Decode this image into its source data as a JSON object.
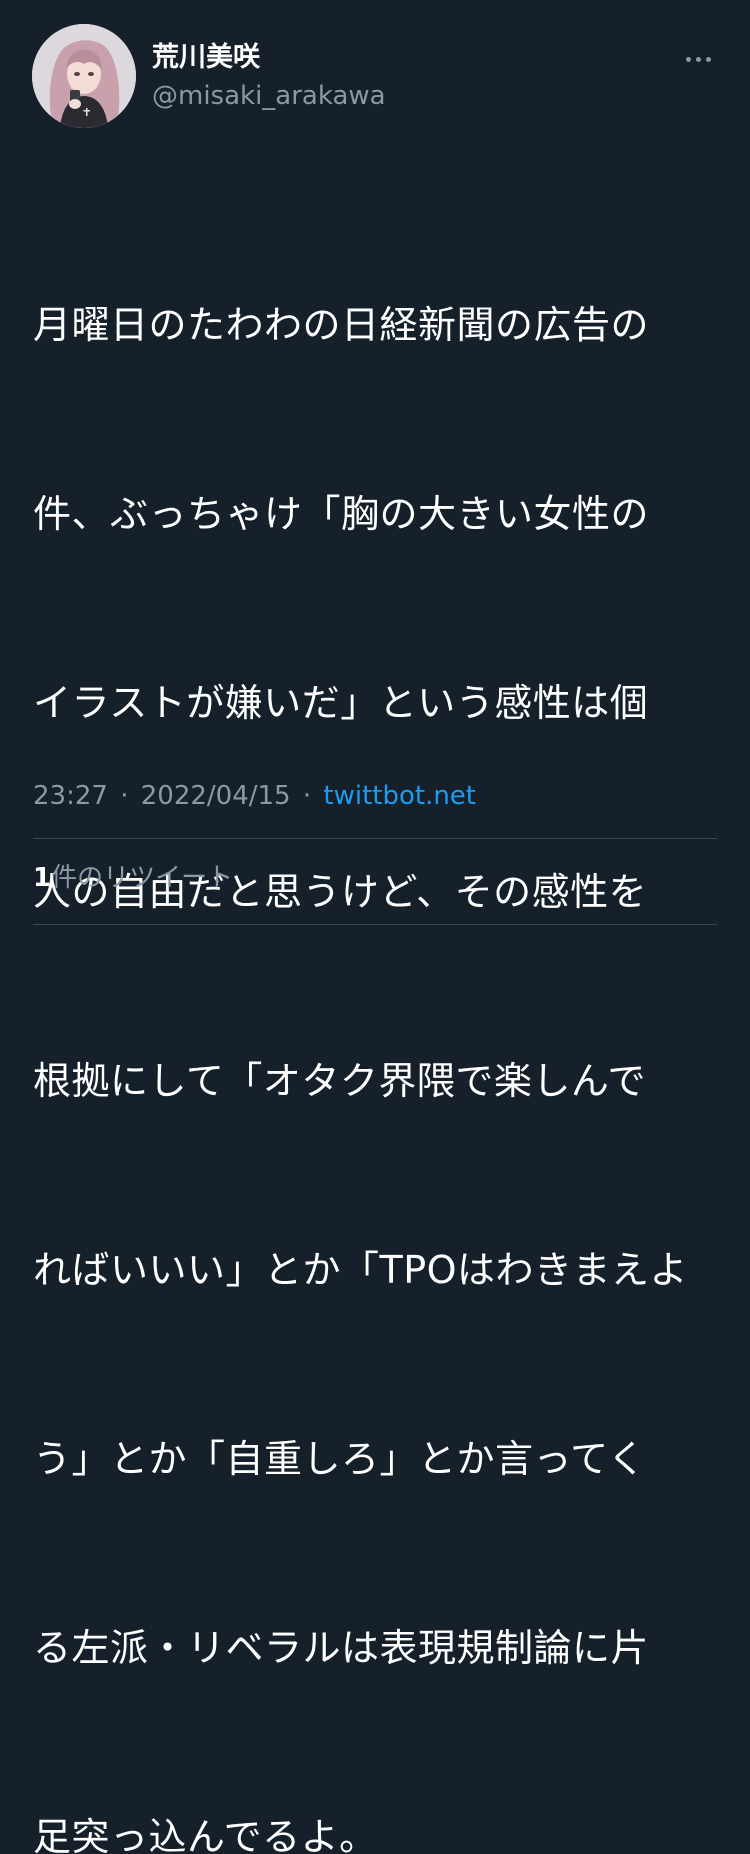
{
  "user": {
    "display_name": "荒川美咲",
    "handle": "@misaki_arakawa",
    "avatar_icon": "user-avatar-illustration"
  },
  "tweet": {
    "lines": [
      "月曜日のたわわの日経新聞の広告の",
      "件、ぶっちゃけ「胸の大きい女性の",
      "イラストが嫌いだ」という感性は個",
      "人の自由だと思うけど、その感性を",
      "根拠にして「オタク界隈で楽しんで",
      "ればいいい」とか「TPOはわきまえよ",
      "う」とか「自重しろ」とか言ってく",
      "る左派・リベラルは表現規制論に片",
      "足突っ込んでるよ。"
    ],
    "time": "23:27",
    "date": "2022/04/15",
    "separator": "·",
    "source": "twittbot.net"
  },
  "stats": {
    "retweet_count": "1",
    "retweet_label": "件のリツイート"
  },
  "colors": {
    "background": "#15202b",
    "text": "#ffffff",
    "secondary": "#8b98a5",
    "link": "#1d9bf0",
    "divider": "#38444d"
  },
  "icons": {
    "more": "more-options-icon"
  }
}
